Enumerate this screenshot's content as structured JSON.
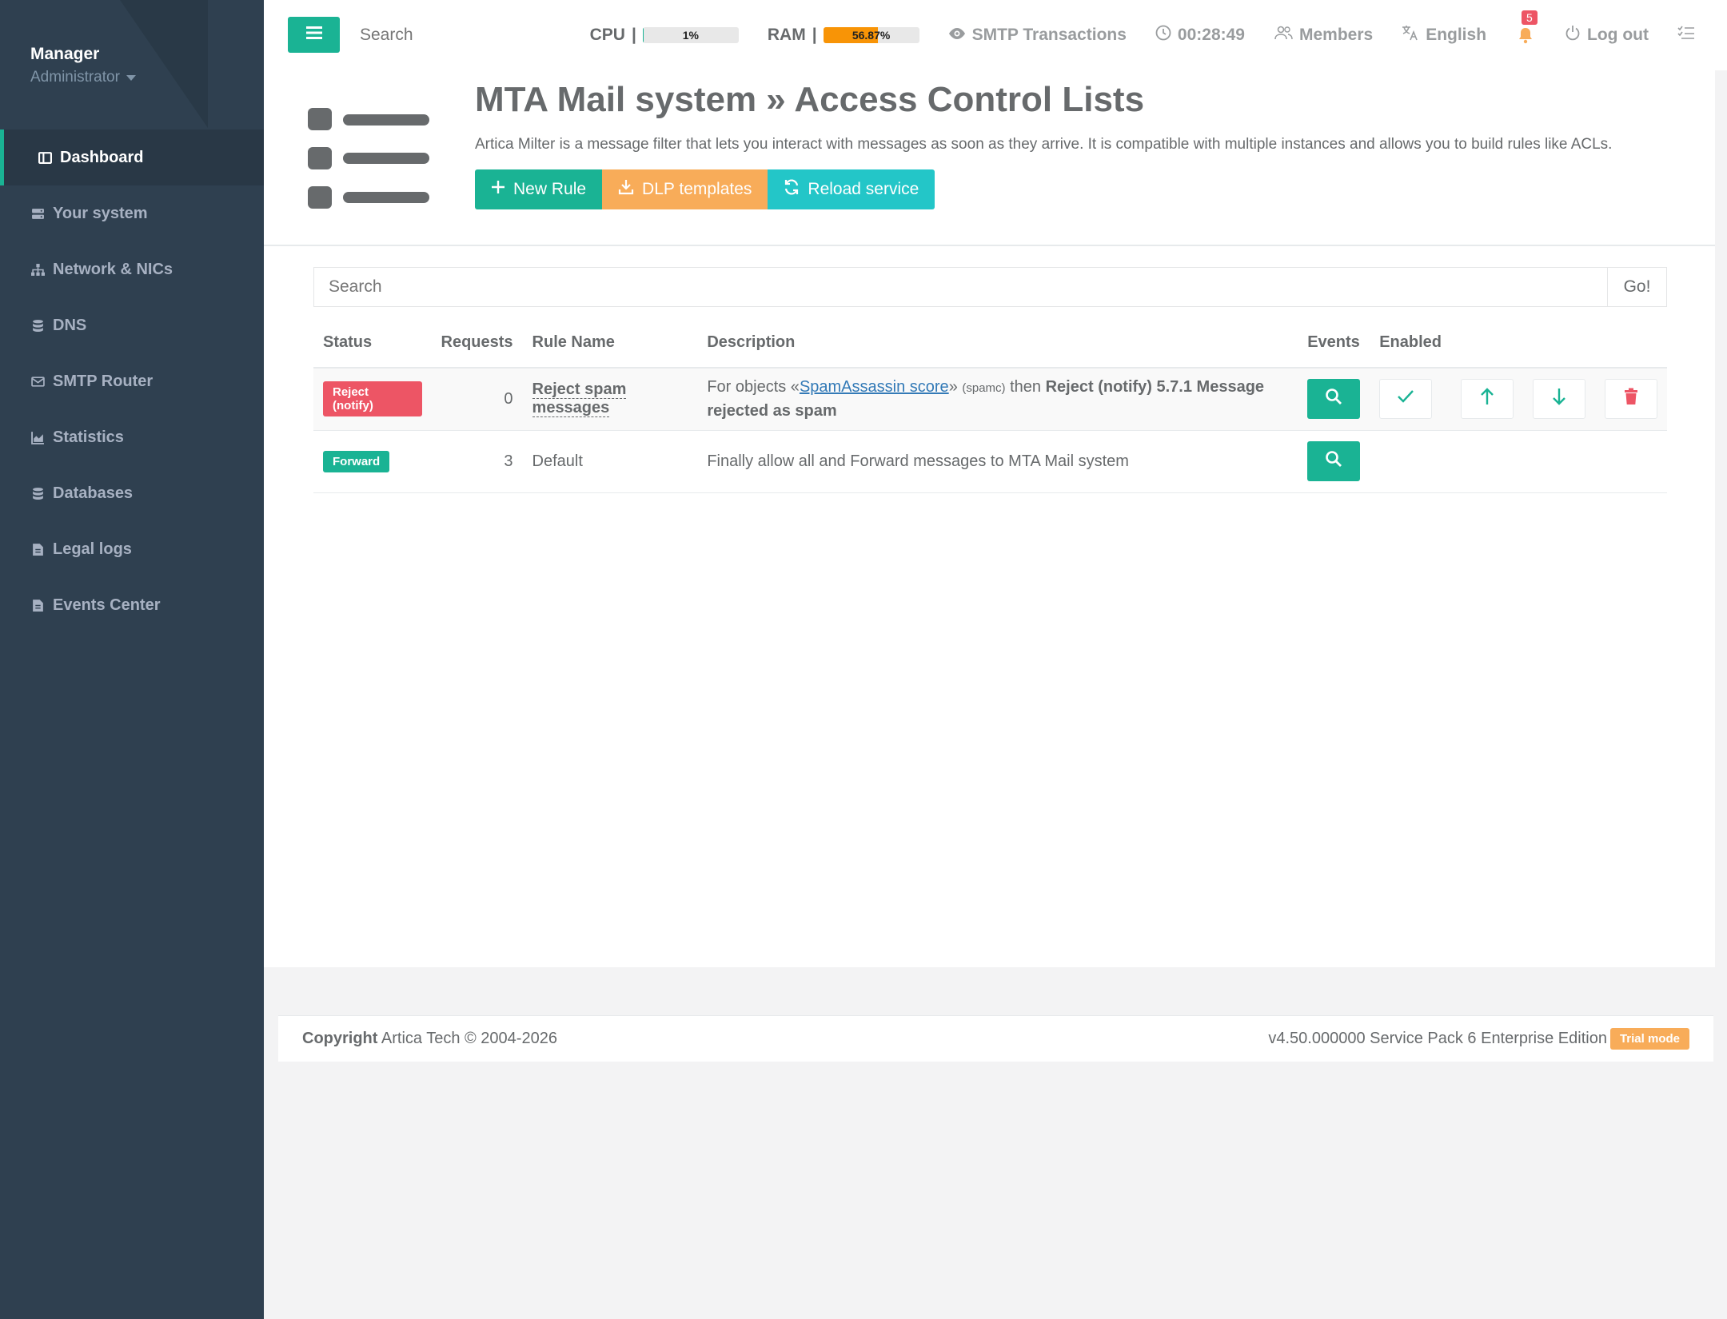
{
  "sidebar": {
    "profile_name": "Manager",
    "profile_role": "Administrator",
    "items": [
      {
        "label": "Dashboard"
      },
      {
        "label": "Your system"
      },
      {
        "label": "Network & NICs"
      },
      {
        "label": "DNS"
      },
      {
        "label": "SMTP Router"
      },
      {
        "label": "Statistics"
      },
      {
        "label": "Databases"
      },
      {
        "label": "Legal logs"
      },
      {
        "label": "Events Center"
      }
    ]
  },
  "topbar": {
    "search_placeholder": "Search",
    "cpu_label": "CPU",
    "cpu_value": "1%",
    "cpu_percent": 1,
    "ram_label": "RAM",
    "ram_value": "56.87%",
    "ram_percent": 56.87,
    "smtp_transactions": "SMTP Transactions",
    "clock": "00:28:49",
    "members": "Members",
    "language": "English",
    "notifications": "5",
    "logout": "Log out"
  },
  "header": {
    "title": "MTA Mail system » Access Control Lists",
    "description": "Artica Milter is a message filter that lets you interact with messages as soon as they arrive. It is compatible with multiple instances and allows you to build rules like ACLs.",
    "btn_new_rule": "New Rule",
    "btn_dlp": "DLP templates",
    "btn_reload": "Reload service"
  },
  "content": {
    "search_placeholder": "Search",
    "go_label": "Go!",
    "columns": [
      "Status",
      "Requests",
      "Rule Name",
      "Description",
      "Events",
      "Enabled"
    ],
    "rows": [
      {
        "status": "Reject (notify)",
        "requests": "0",
        "name": "Reject spam messages",
        "desc_prefix": "For objects «",
        "desc_link": "SpamAssassin score",
        "desc_mid": "»",
        "desc_small": "(spamc)",
        "desc_then": "then",
        "desc_bold": "Reject (notify) 5.7.1 Message rejected as spam"
      },
      {
        "status": "Forward",
        "requests": "3",
        "name": "Default",
        "desc": "Finally allow all and Forward messages to MTA Mail system"
      }
    ]
  },
  "footer": {
    "copyright_bold": "Copyright",
    "copyright_text": "Artica Tech © 2004-2026",
    "version": "v4.50.000000 Service Pack 6 Enterprise Edition",
    "trial": "Trial mode"
  },
  "colors": {
    "primary": "#1ab394",
    "warning": "#f8ac59",
    "info": "#23c6c8",
    "danger": "#ed5565",
    "sidebar": "#2f4050"
  }
}
